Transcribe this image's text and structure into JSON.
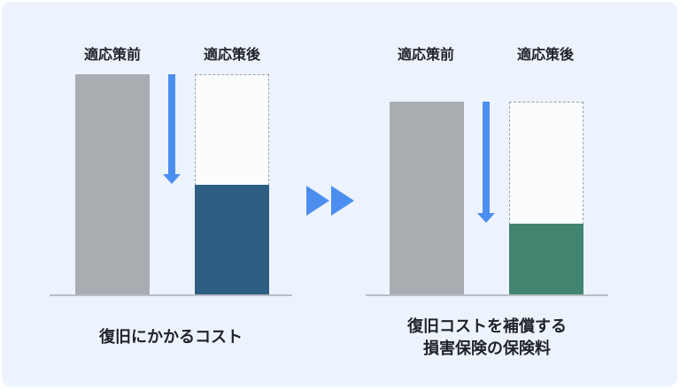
{
  "left_panel": {
    "before_label": "適応策前",
    "after_label": "適応策後",
    "caption": "復旧にかかるコスト"
  },
  "right_panel": {
    "before_label": "適応策前",
    "after_label": "適応策後",
    "caption_line1": "復旧コストを補償する",
    "caption_line2": "損害保険の保険料"
  },
  "colors": {
    "background": "#edf3fc",
    "before_bar": "#a9adb2",
    "left_after_fill": "#2e5f82",
    "right_after_fill": "#418570",
    "arrow": "#4b8ef0",
    "dashed_outline": "#9ba2ab"
  },
  "icons": {
    "left_reduction": "arrow-down-icon",
    "right_reduction": "arrow-down-icon",
    "transition": "double-triangle-right-icon"
  }
}
